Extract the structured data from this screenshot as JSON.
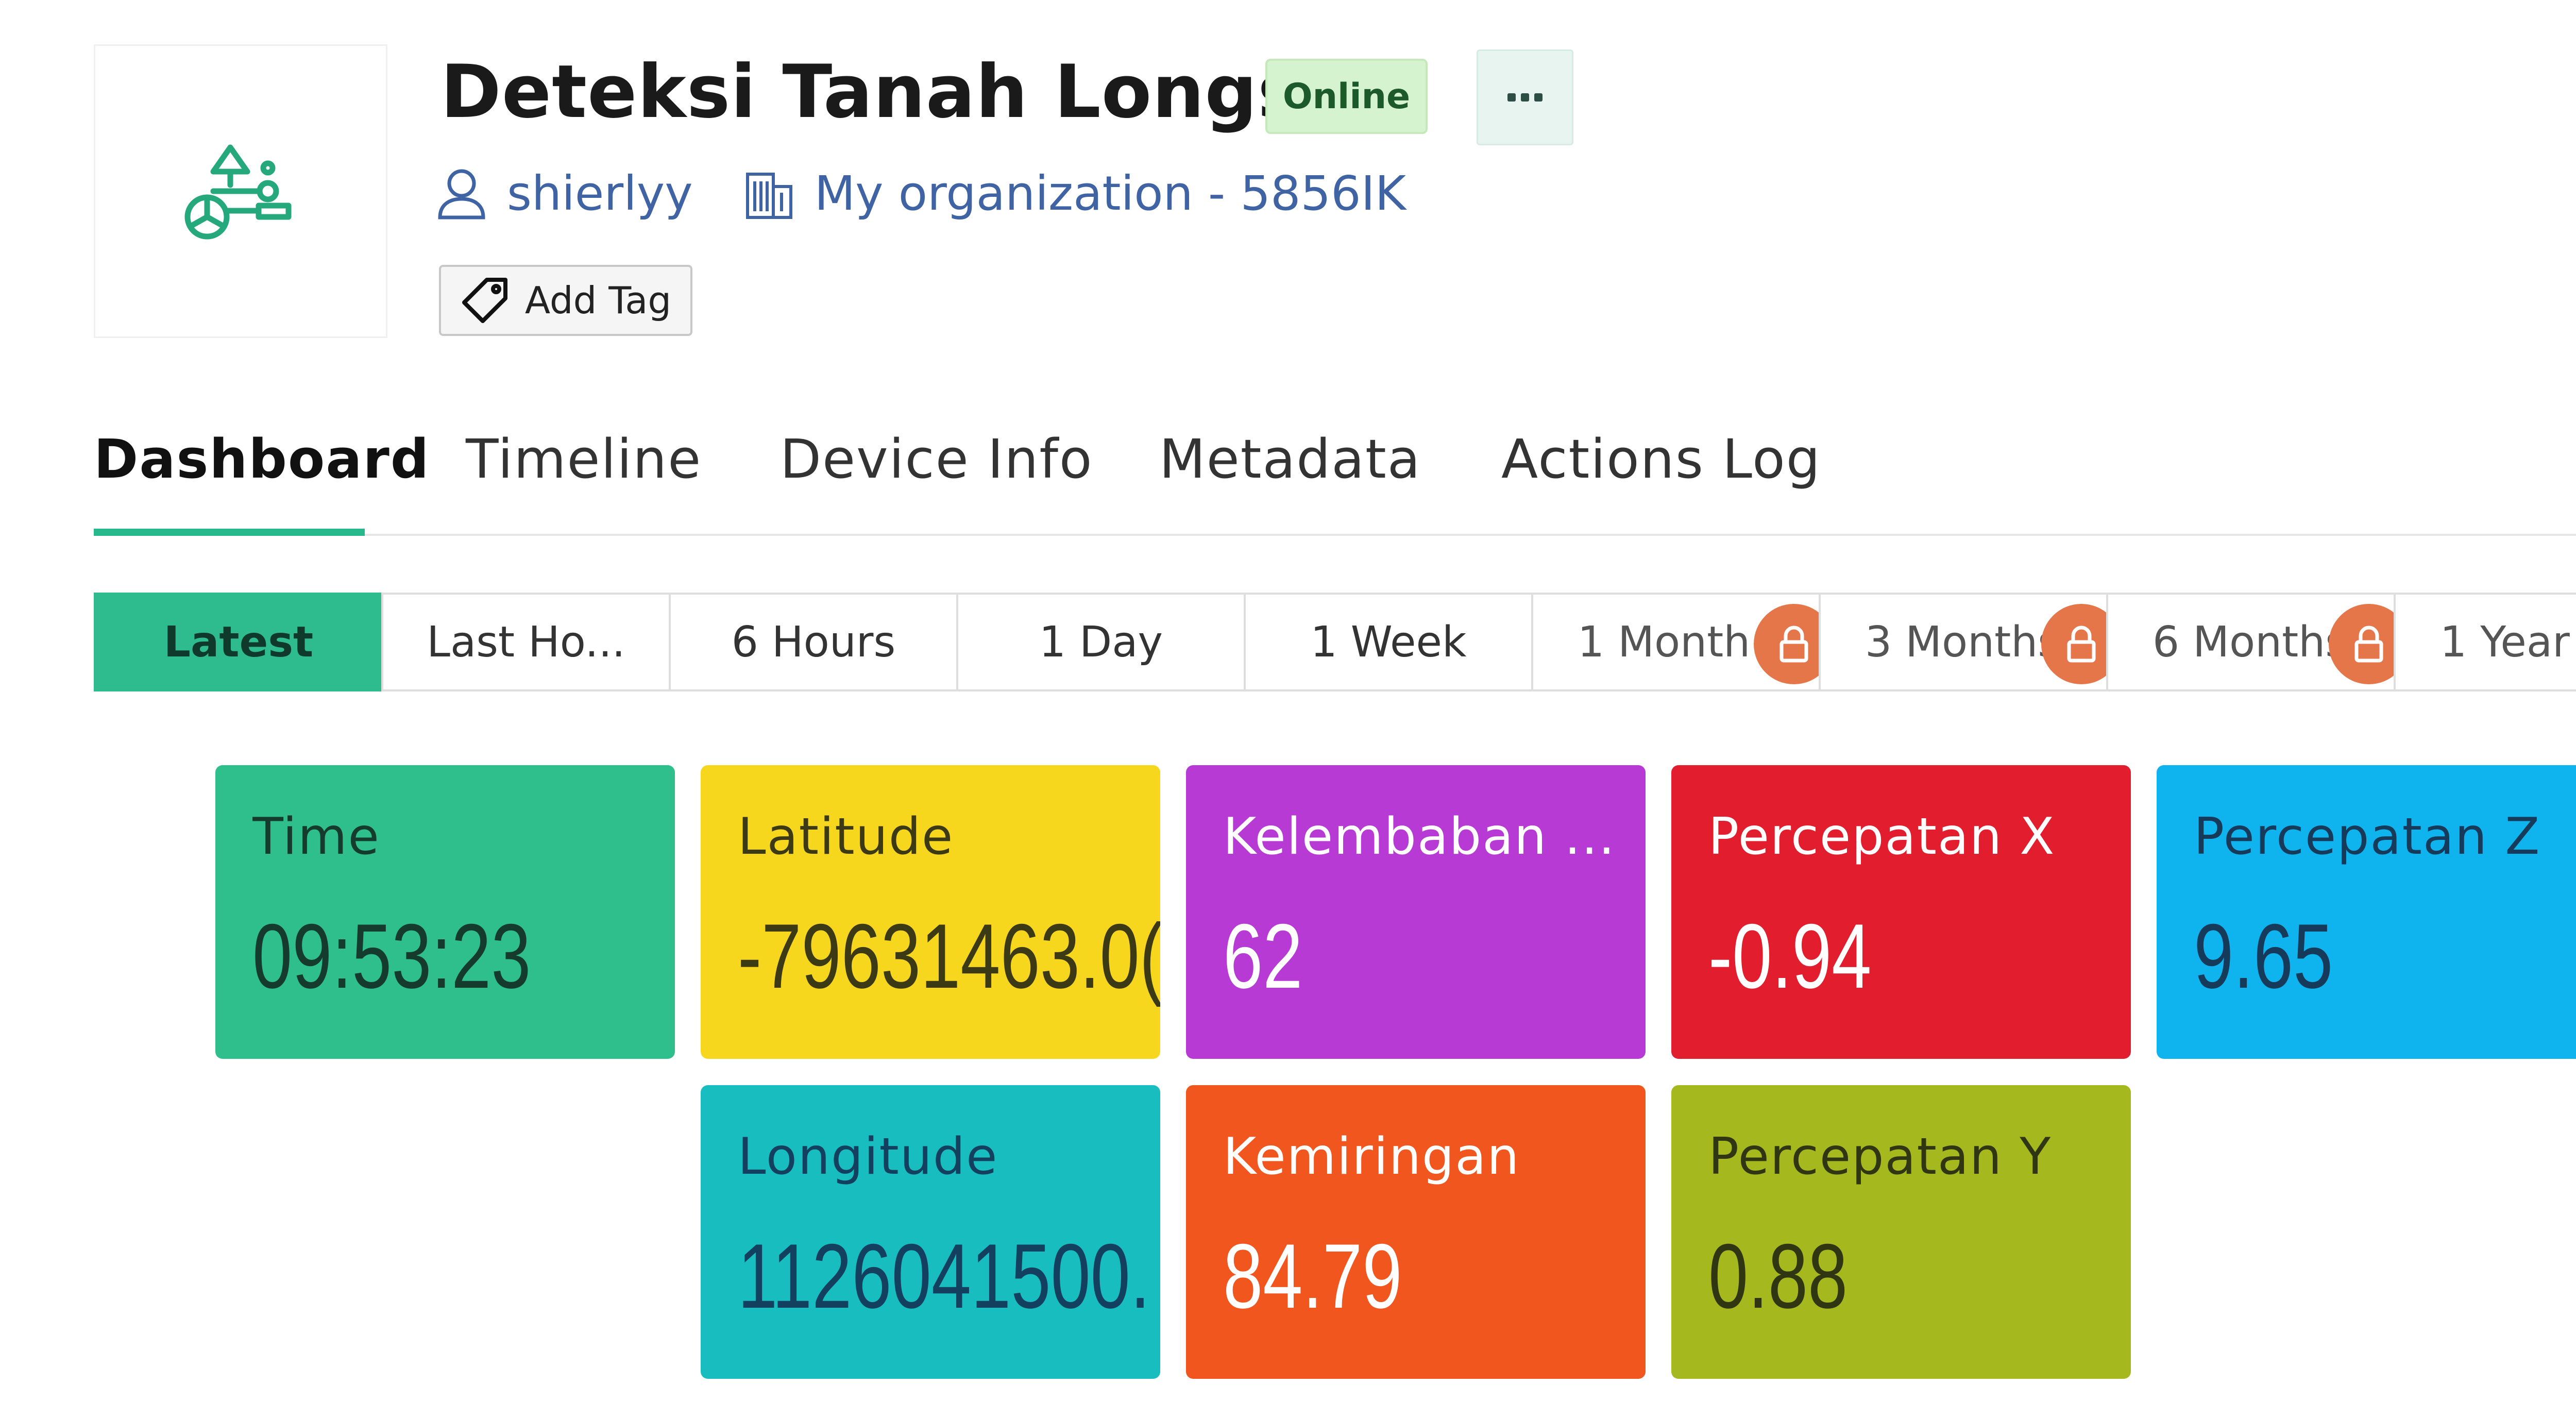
{
  "header": {
    "title": "Deteksi Tanah Longsor",
    "status": "Online",
    "owner": "shierlyy",
    "organization": "My organization - 5856IK",
    "add_tag_label": "Add Tag"
  },
  "tabs": [
    {
      "label": "Dashboard",
      "active": true
    },
    {
      "label": "Timeline",
      "active": false
    },
    {
      "label": "Device Info",
      "active": false
    },
    {
      "label": "Metadata",
      "active": false
    },
    {
      "label": "Actions Log",
      "active": false
    }
  ],
  "time_ranges": [
    {
      "label": "Latest",
      "active": true,
      "locked": false
    },
    {
      "label": "Last Ho...",
      "active": false,
      "locked": false
    },
    {
      "label": "6 Hours",
      "active": false,
      "locked": false
    },
    {
      "label": "1 Day",
      "active": false,
      "locked": false
    },
    {
      "label": "1 Week",
      "active": false,
      "locked": false
    },
    {
      "label": "1 Month",
      "active": false,
      "locked": true
    },
    {
      "label": "3 Months",
      "active": false,
      "locked": true
    },
    {
      "label": "6 Months",
      "active": false,
      "locked": true
    },
    {
      "label": "1 Year",
      "active": false,
      "locked": true
    }
  ],
  "widgets": {
    "time": {
      "label": "Time",
      "value": "09:53:23",
      "color": "#2ebf8d"
    },
    "latitude": {
      "label": "Latitude",
      "value": "-79631463.0(",
      "color": "#f7d71e"
    },
    "humidity": {
      "label": "Kelembaban ...",
      "value": "62",
      "color": "#b73ad4"
    },
    "acc_x": {
      "label": "Percepatan X",
      "value": "-0.94",
      "color": "#e21e2e"
    },
    "acc_z": {
      "label": "Percepatan Z",
      "value": "9.65",
      "color": "#0fb4ef"
    },
    "longitude": {
      "label": "Longitude",
      "value": "1126041500.",
      "color": "#17bdbf"
    },
    "tilt": {
      "label": "Kemiringan",
      "value": "84.79",
      "color": "#f2561f"
    },
    "acc_y": {
      "label": "Percepatan Y",
      "value": "0.88",
      "color": "#a5b81d"
    }
  },
  "colors": {
    "accent": "#27b98b",
    "link": "#3f63a3",
    "lock": "#e5764a"
  }
}
